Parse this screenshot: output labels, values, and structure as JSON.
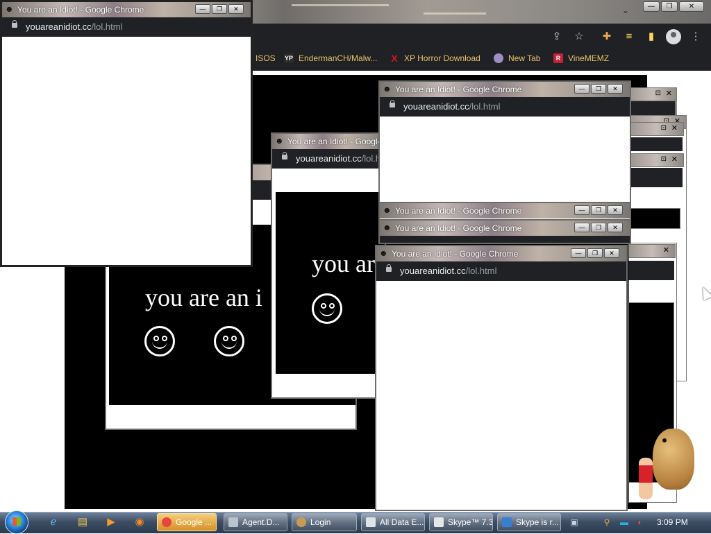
{
  "popup_title": "You are an Idiot! - Google Chrome",
  "popup_url_domain": "youareanidiot.cc",
  "popup_url_path": "/lol.html",
  "idiot_text": "you are an idiot",
  "idiot_text_partial_1": "you are an i",
  "idiot_text_partial_2": "you ar",
  "bookmarks": [
    {
      "label": "ISOS"
    },
    {
      "label": "EndermanCH/Malw...",
      "icon_text": "YP",
      "icon_color": "#2b2b2b"
    },
    {
      "label": "XP Horror Download",
      "icon_text": "X",
      "icon_color": "#d1161b"
    },
    {
      "label": "New Tab",
      "icon_color": "#9e8ec5"
    },
    {
      "label": "VineMEMZ",
      "icon_text": "R",
      "icon_color": "#c6203b"
    }
  ],
  "taskbar": {
    "items": [
      {
        "label": "Google ...",
        "icon_color": "#e8453c",
        "active": true
      },
      {
        "label": "Agent.D...",
        "icon_color": "#b9c3cf"
      },
      {
        "label": "Login",
        "icon_color": "#c89b55"
      },
      {
        "label": "All Data E...",
        "icon_color": "#dfe3e8"
      },
      {
        "label": "Skype™ 7.3",
        "icon_color": "#e6e6e6"
      },
      {
        "label": "Skype is r...",
        "icon_color": "#3a7ed3"
      }
    ],
    "clock": "3:09 PM"
  },
  "colors": {
    "chrome_dark": "#202124",
    "bookmark_text": "#e8c16b",
    "page_black": "#000000"
  }
}
